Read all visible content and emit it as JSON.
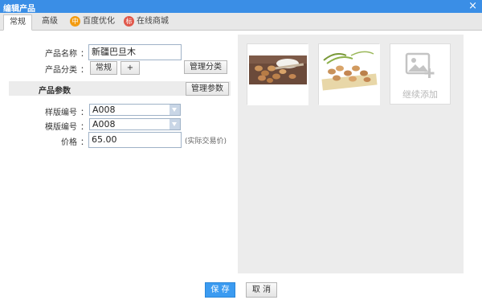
{
  "window": {
    "title": "编辑产品",
    "close_glyph": "×"
  },
  "tabs": [
    {
      "label": "常规",
      "active": true
    },
    {
      "label": "高级"
    },
    {
      "label": "百度优化",
      "badge": "中"
    },
    {
      "label": "在线商城",
      "badge": "标"
    }
  ],
  "form": {
    "name_label": "产品名称",
    "name_value": "新疆巴旦木",
    "category_label": "产品分类",
    "category_tag": "常规",
    "category_add": "+",
    "manage_category": "管理分类",
    "params_section": "产品参数",
    "manage_params": "管理参数",
    "sample_label": "样版编号",
    "sample_value": "A008",
    "template_label": "模版编号",
    "template_value": "A008",
    "price_label": "价格",
    "price_value": "65.00",
    "price_hint": "(实际交易价)",
    "colon": "："
  },
  "images": {
    "add_label": "继续添加"
  },
  "footer": {
    "save": "保 存",
    "cancel": "取 消"
  }
}
